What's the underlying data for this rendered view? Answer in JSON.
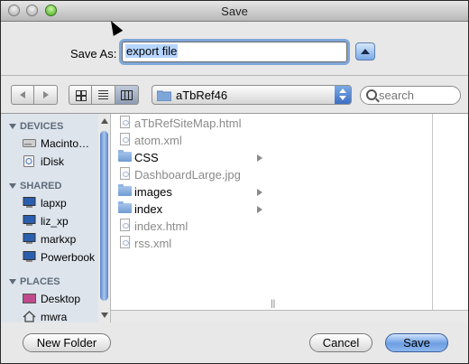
{
  "window": {
    "title": "Save"
  },
  "save_as": {
    "label": "Save As:",
    "value": "export file"
  },
  "toolbar": {
    "location": "aTbRef46",
    "search_placeholder": "search"
  },
  "sidebar": {
    "devices_header": "DEVICES",
    "devices": [
      {
        "label": "Macinto…",
        "icon": "hard-drive-icon"
      },
      {
        "label": "iDisk",
        "icon": "idisk-icon"
      }
    ],
    "shared_header": "SHARED",
    "shared": [
      {
        "label": "lapxp",
        "icon": "network-computer-icon"
      },
      {
        "label": "liz_xp",
        "icon": "network-computer-icon"
      },
      {
        "label": "markxp",
        "icon": "network-computer-icon"
      },
      {
        "label": "Powerbook",
        "icon": "network-computer-icon"
      }
    ],
    "places_header": "PLACES",
    "places": [
      {
        "label": "Desktop",
        "icon": "desktop-icon"
      },
      {
        "label": "mwra",
        "icon": "home-icon"
      }
    ]
  },
  "files": [
    {
      "name": "aTbRefSiteMap.html",
      "kind": "file",
      "enabled": false
    },
    {
      "name": "atom.xml",
      "kind": "file",
      "enabled": false
    },
    {
      "name": "CSS",
      "kind": "folder",
      "enabled": true
    },
    {
      "name": "DashboardLarge.jpg",
      "kind": "file",
      "enabled": false
    },
    {
      "name": "images",
      "kind": "folder",
      "enabled": true
    },
    {
      "name": "index",
      "kind": "folder",
      "enabled": true
    },
    {
      "name": "index.html",
      "kind": "file",
      "enabled": false
    },
    {
      "name": "rss.xml",
      "kind": "file",
      "enabled": false
    }
  ],
  "buttons": {
    "new_folder": "New Folder",
    "cancel": "Cancel",
    "save": "Save"
  },
  "colors": {
    "accent": "#6c9ee3",
    "sidebar_bg": "#dde4ec",
    "section_header": "#5e6b7a"
  }
}
